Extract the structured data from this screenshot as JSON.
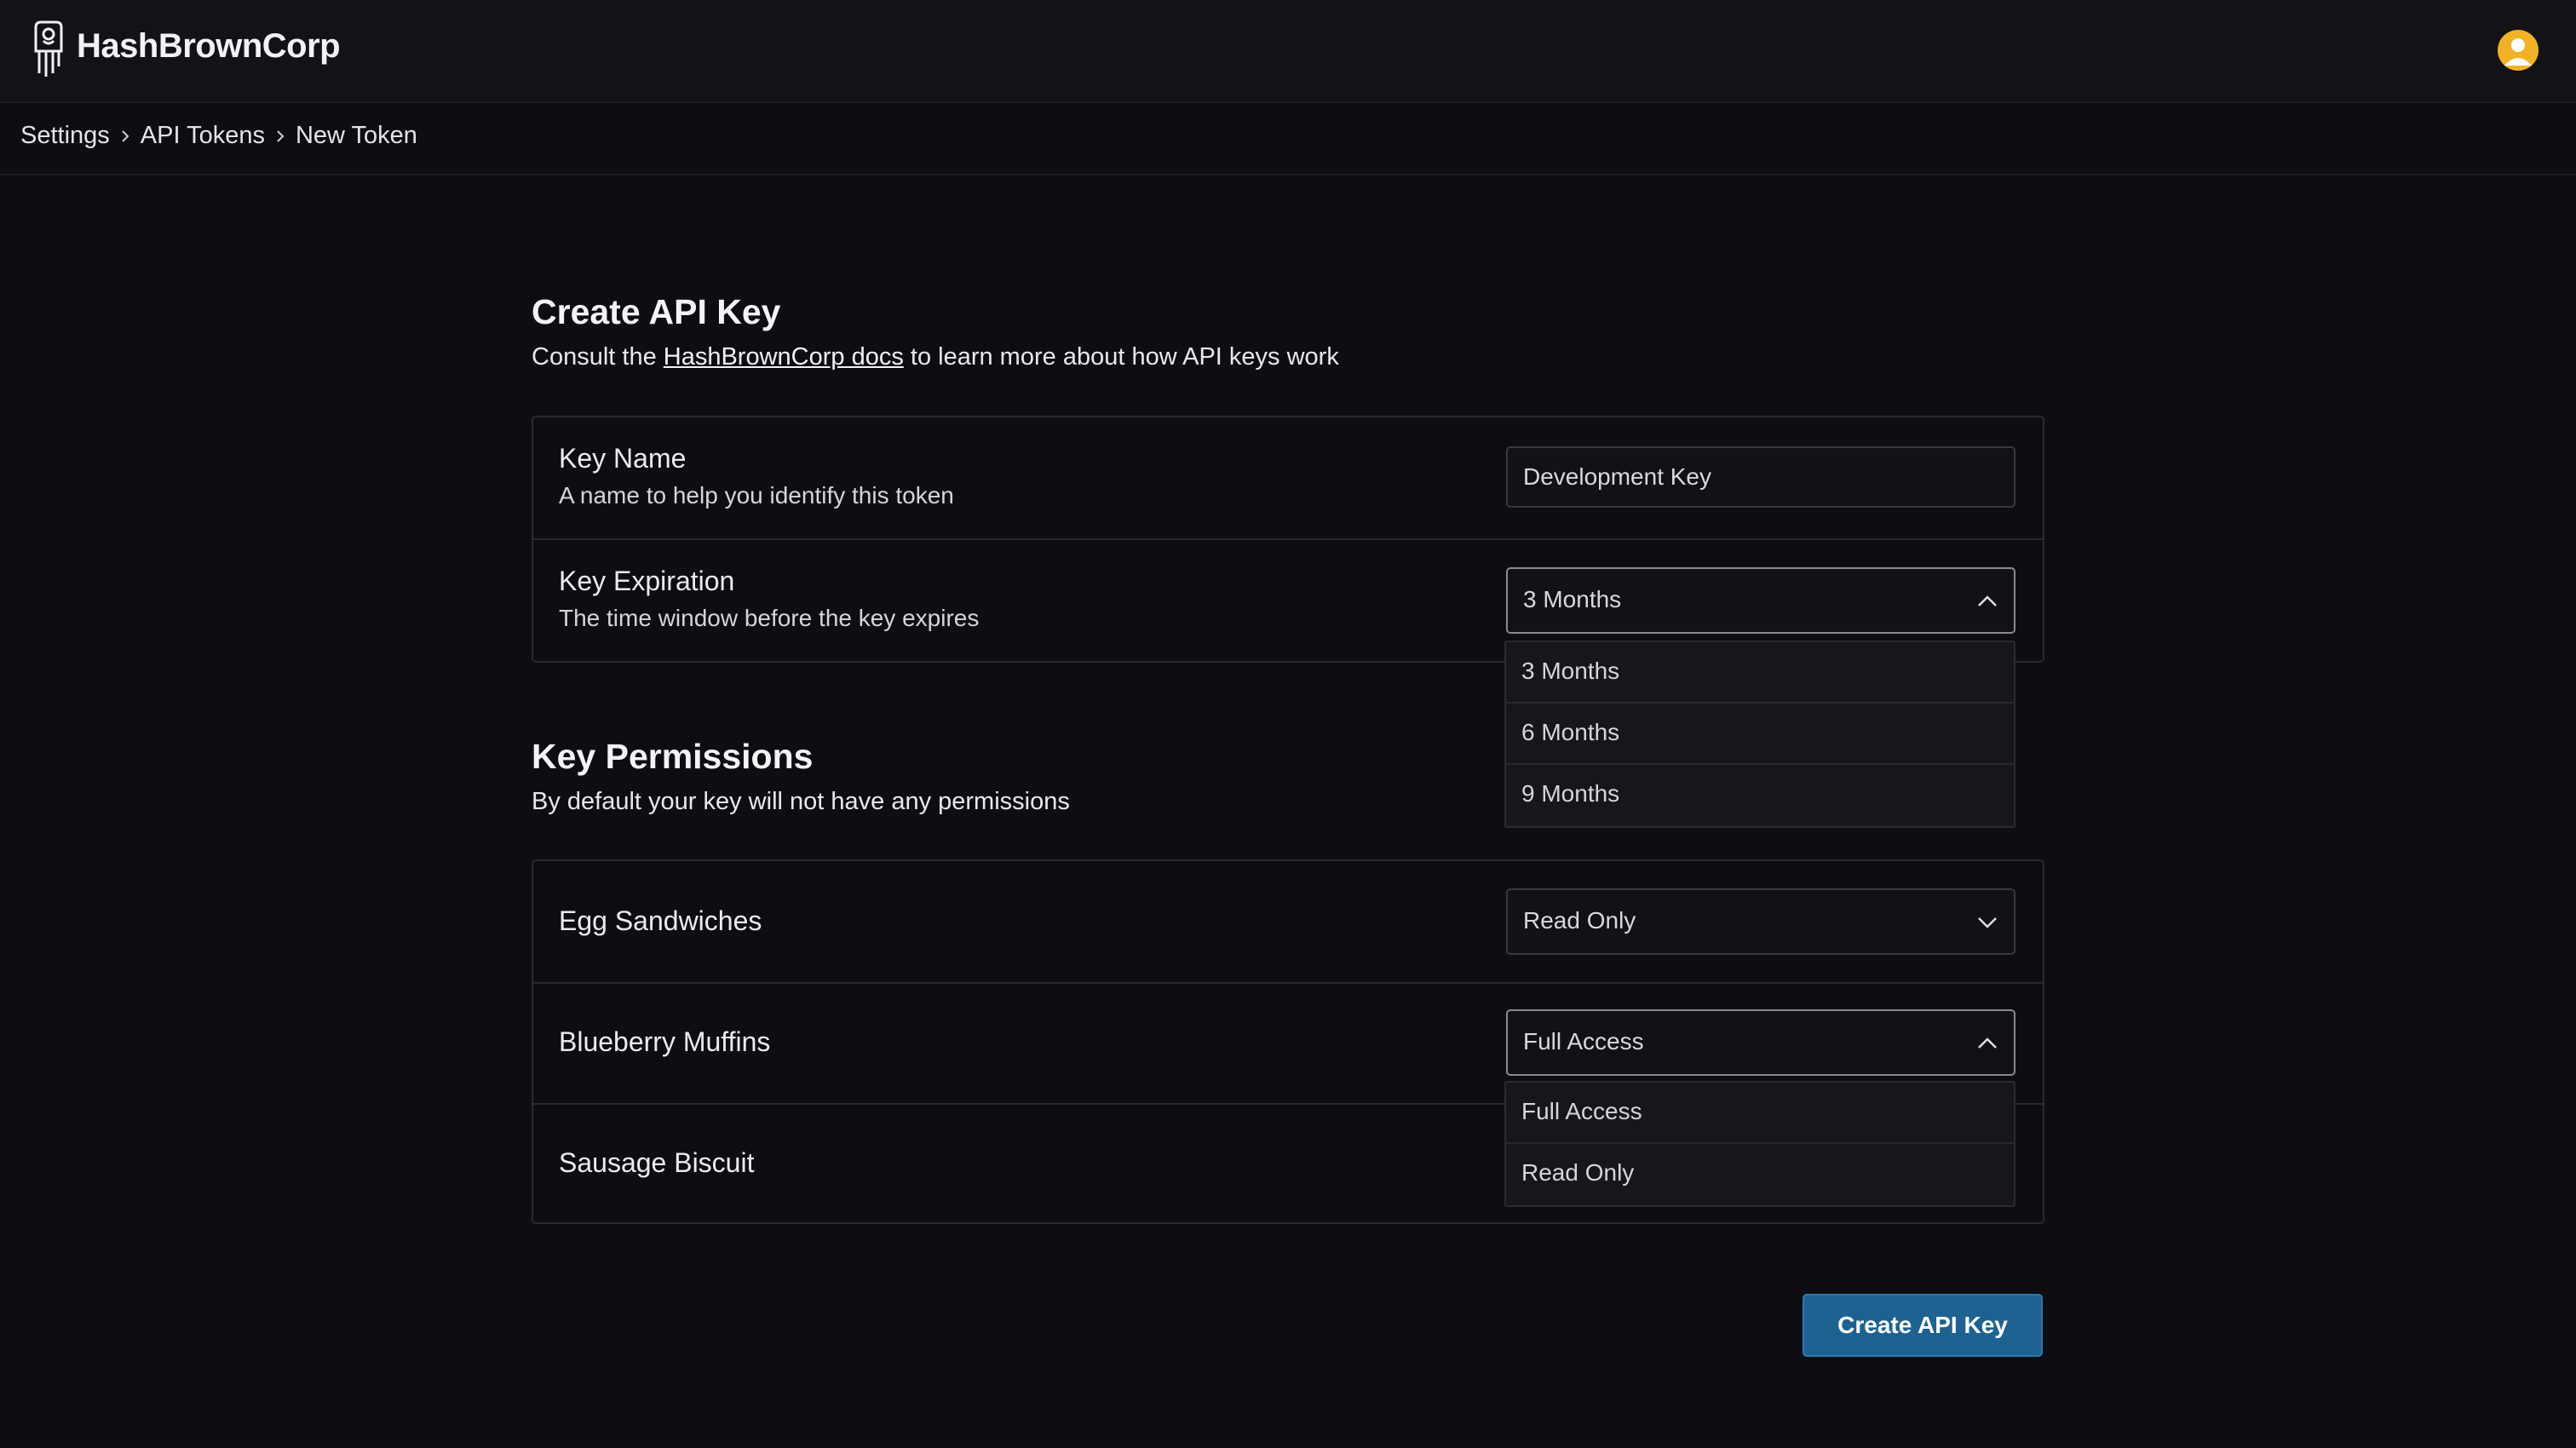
{
  "app": {
    "brand": "HashBrownCorp"
  },
  "breadcrumb": [
    "Settings",
    "API Tokens",
    "New Token"
  ],
  "create_section": {
    "title": "Create API Key",
    "subtitle_prefix": "Consult the ",
    "docs_link": "HashBrownCorp docs",
    "subtitle_suffix": " to learn more about how API keys work"
  },
  "key_name": {
    "label": "Key Name",
    "description": "A name to help you identify this token",
    "value": "Development Key"
  },
  "key_expiration": {
    "label": "Key Expiration",
    "description": "The time window before the key expires",
    "selected": "3 Months",
    "options": [
      "3 Months",
      "6 Months",
      "9 Months"
    ]
  },
  "permissions_section": {
    "title": "Key Permissions",
    "subtitle": "By default your key will not have any permissions"
  },
  "permissions": [
    {
      "label": "Egg Sandwiches",
      "selected": "Read Only"
    },
    {
      "label": "Blueberry Muffins",
      "selected": "Full Access",
      "options": [
        "Full Access",
        "Read Only"
      ]
    },
    {
      "label": "Sausage Biscuit"
    }
  ],
  "actions": {
    "create_label": "Create API Key"
  },
  "colors": {
    "accent": "#1d6291",
    "avatar": "#f1b325",
    "background": "#0e0d12"
  },
  "icons": [
    "hashbrown-logo-icon",
    "user-avatar-icon",
    "chevron-right-icon",
    "chevron-up-icon",
    "chevron-down-icon"
  ]
}
